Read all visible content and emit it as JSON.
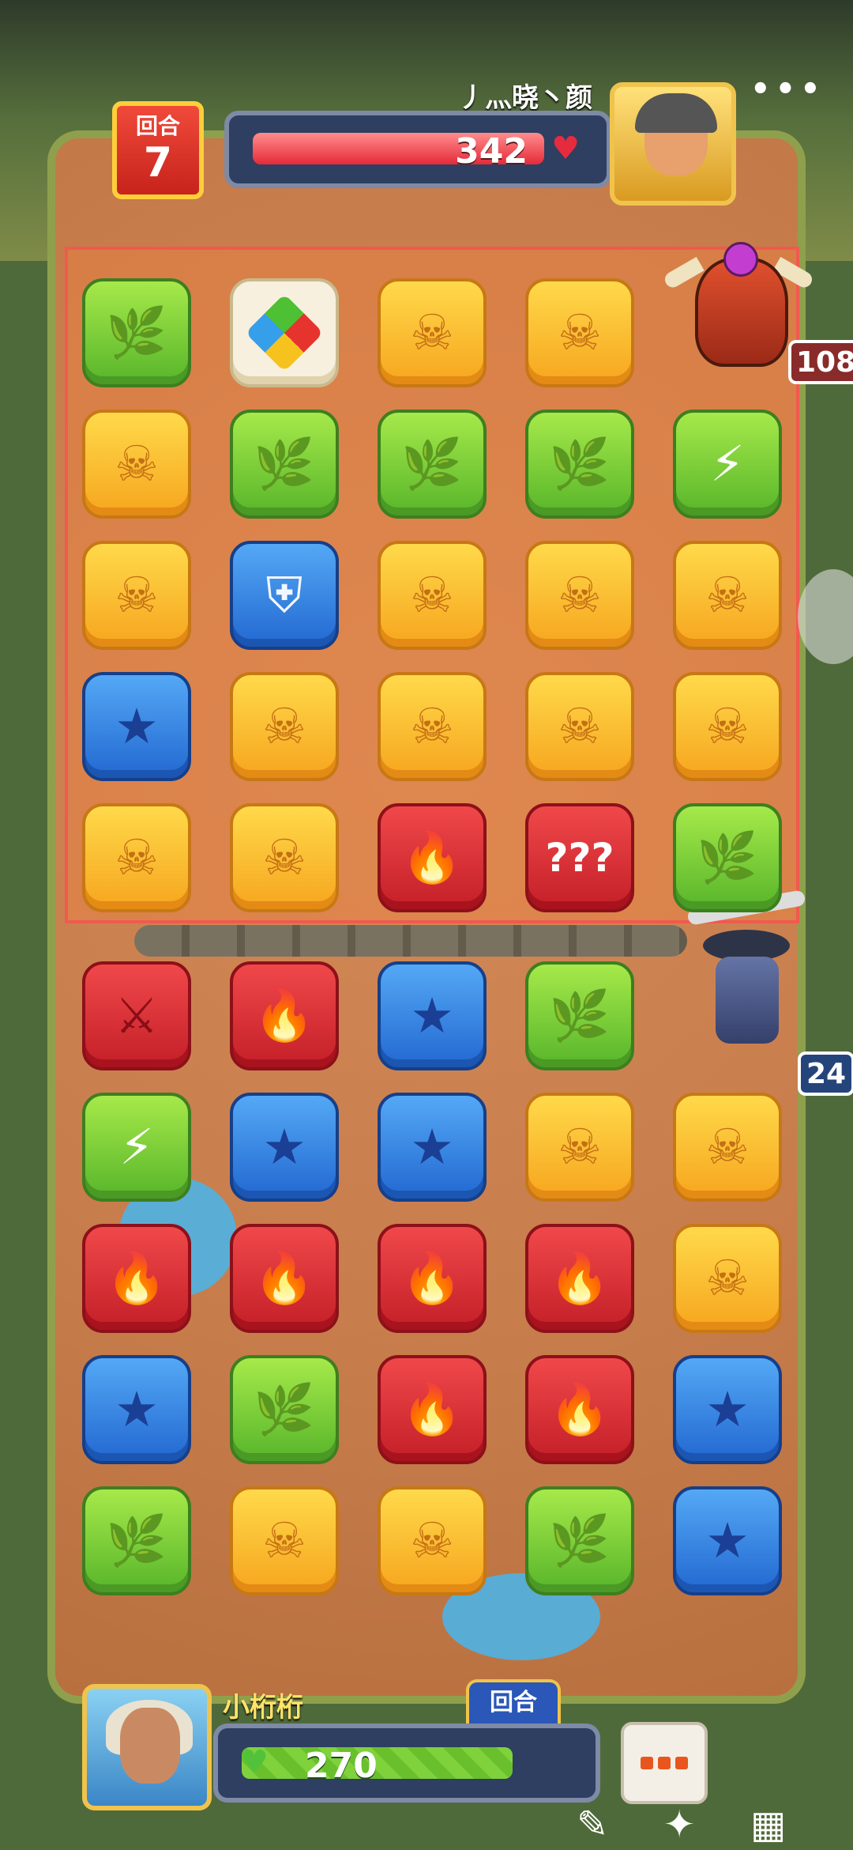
{
  "hud_top": {
    "turn_label": "回合",
    "turn_number": "7",
    "opponent_name": "丿灬晓丶颜",
    "opponent_hp": "342",
    "opponent_hp_fraction": 0.82
  },
  "enemy_characters": {
    "boss_badge": "108",
    "knight_badge": "24"
  },
  "board": {
    "enemy_rows": [
      [
        "leaf",
        "rainbow",
        "skull",
        "skull",
        "empty"
      ],
      [
        "skull",
        "leaf",
        "leaf",
        "leaf",
        "bolt"
      ],
      [
        "skull",
        "shield",
        "skull",
        "skull",
        "skull"
      ],
      [
        "star",
        "skull",
        "skull",
        "skull",
        "skull"
      ],
      [
        "skull",
        "skull",
        "fire",
        "question",
        "leaf"
      ]
    ],
    "player_rows": [
      [
        "axe",
        "fire",
        "star",
        "leaf",
        "empty"
      ],
      [
        "bolt",
        "star",
        "star",
        "skull",
        "skull"
      ],
      [
        "fire",
        "fire",
        "fire",
        "fire",
        "skull"
      ],
      [
        "star",
        "leaf",
        "fire",
        "fire",
        "star"
      ],
      [
        "leaf",
        "skull",
        "skull",
        "leaf",
        "star"
      ]
    ],
    "tile_colors": {
      "leaf": "green",
      "skull": "yellow",
      "fire": "red",
      "star": "blue",
      "shield": "blue",
      "bolt": "green",
      "axe": "red",
      "question": "red",
      "rainbow": "white"
    },
    "icons": {
      "leaf": "🌿",
      "skull": "☠",
      "fire": "🔥",
      "star": "★",
      "shield": "⛨",
      "bolt": "⚡",
      "axe": "⚔",
      "question": "???",
      "rainbow": ""
    }
  },
  "hud_bottom": {
    "player_name": "小桁桁",
    "player_hp": "270",
    "player_hp_fraction": 0.78,
    "turn_tab_label": "回合"
  },
  "colors": {
    "enemy_zone_border": "#f05a4f",
    "hp_red": "#e52a39",
    "hp_green": "#7fd23c"
  }
}
